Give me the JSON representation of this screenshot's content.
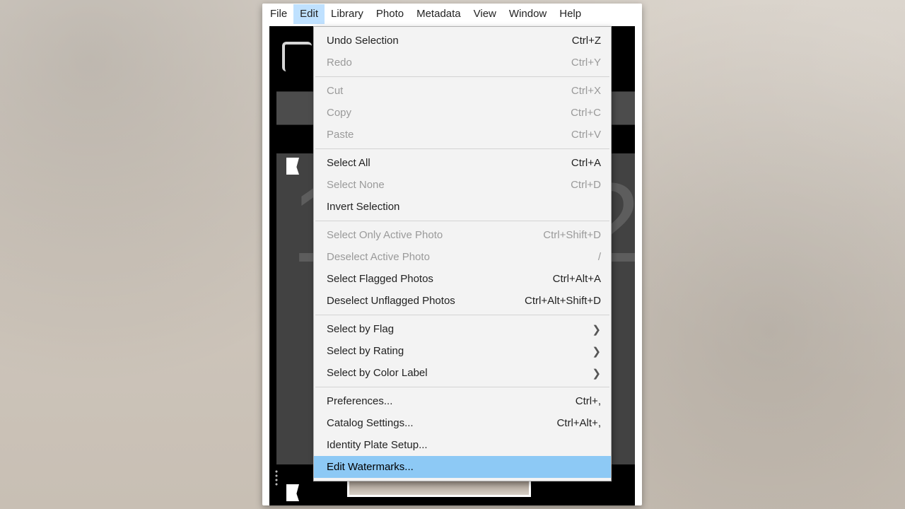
{
  "menubar": {
    "items": [
      {
        "label": "File"
      },
      {
        "label": "Edit"
      },
      {
        "label": "Library"
      },
      {
        "label": "Photo"
      },
      {
        "label": "Metadata"
      },
      {
        "label": "View"
      },
      {
        "label": "Window"
      },
      {
        "label": "Help"
      }
    ],
    "active_index": 1
  },
  "edit_menu": {
    "items": [
      {
        "label": "Undo Selection",
        "accel": "Ctrl+Z",
        "disabled": false
      },
      {
        "label": "Redo",
        "accel": "Ctrl+Y",
        "disabled": true
      },
      {
        "sep": true
      },
      {
        "label": "Cut",
        "accel": "Ctrl+X",
        "disabled": true
      },
      {
        "label": "Copy",
        "accel": "Ctrl+C",
        "disabled": true
      },
      {
        "label": "Paste",
        "accel": "Ctrl+V",
        "disabled": true
      },
      {
        "sep": true
      },
      {
        "label": "Select All",
        "accel": "Ctrl+A",
        "disabled": false
      },
      {
        "label": "Select None",
        "accel": "Ctrl+D",
        "disabled": true
      },
      {
        "label": "Invert Selection",
        "accel": "",
        "disabled": false
      },
      {
        "sep": true
      },
      {
        "label": "Select Only Active Photo",
        "accel": "Ctrl+Shift+D",
        "disabled": true
      },
      {
        "label": "Deselect Active Photo",
        "accel": "/",
        "disabled": true
      },
      {
        "label": "Select Flagged Photos",
        "accel": "Ctrl+Alt+A",
        "disabled": false
      },
      {
        "label": "Deselect Unflagged Photos",
        "accel": "Ctrl+Alt+Shift+D",
        "disabled": false
      },
      {
        "sep": true
      },
      {
        "label": "Select by Flag",
        "accel": "",
        "submenu": true,
        "disabled": false
      },
      {
        "label": "Select by Rating",
        "accel": "",
        "submenu": true,
        "disabled": false
      },
      {
        "label": "Select by Color Label",
        "accel": "",
        "submenu": true,
        "disabled": false
      },
      {
        "sep": true
      },
      {
        "label": "Preferences...",
        "accel": "Ctrl+,",
        "disabled": false
      },
      {
        "label": "Catalog Settings...",
        "accel": "Ctrl+Alt+,",
        "disabled": false
      },
      {
        "label": "Identity Plate Setup...",
        "accel": "",
        "disabled": false
      },
      {
        "label": "Edit Watermarks...",
        "accel": "",
        "disabled": false,
        "highlight": true
      }
    ]
  },
  "submenu_glyph": "❯",
  "bg_digits": {
    "d1": "1",
    "d2": "2"
  }
}
